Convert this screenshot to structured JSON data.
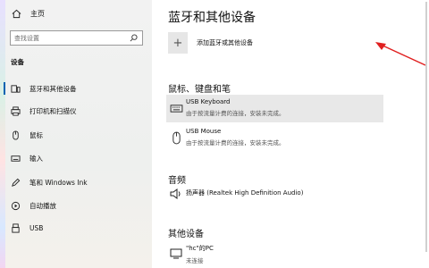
{
  "sidebar": {
    "home_label": "主页",
    "search_placeholder": "查找设置",
    "section_label": "设备",
    "items": [
      {
        "label": "蓝牙和其他设备",
        "icon": "bluetooth-icon",
        "active": true
      },
      {
        "label": "打印机和扫描仪",
        "icon": "printer-icon"
      },
      {
        "label": "鼠标",
        "icon": "mouse-icon"
      },
      {
        "label": "输入",
        "icon": "keyboard-icon"
      },
      {
        "label": "笔和 Windows Ink",
        "icon": "pen-icon"
      },
      {
        "label": "自动播放",
        "icon": "autoplay-icon"
      },
      {
        "label": "USB",
        "icon": "usb-icon"
      }
    ]
  },
  "main": {
    "title": "蓝牙和其他设备",
    "add_label": "添加蓝牙或其他设备",
    "sections": {
      "mouse_keyboard_pen": "鼠标、键盘和笔",
      "audio": "音频",
      "other": "其他设备"
    },
    "devices": {
      "keyboard": {
        "name": "USB Keyboard",
        "status": "由于按流量计费的连接，安装未完成。"
      },
      "mouse": {
        "name": "USB Mouse",
        "status": "由于按流量计费的连接，安装未完成。"
      },
      "speaker": {
        "name": "扬声器 (Realtek High Definition Audio)"
      },
      "pc": {
        "name": "\"hc\"的PC",
        "status": "未连接"
      }
    }
  },
  "colors": {
    "accent": "#0063b1",
    "arrow": "#e02020",
    "selected_row": "#e8e8e8"
  }
}
